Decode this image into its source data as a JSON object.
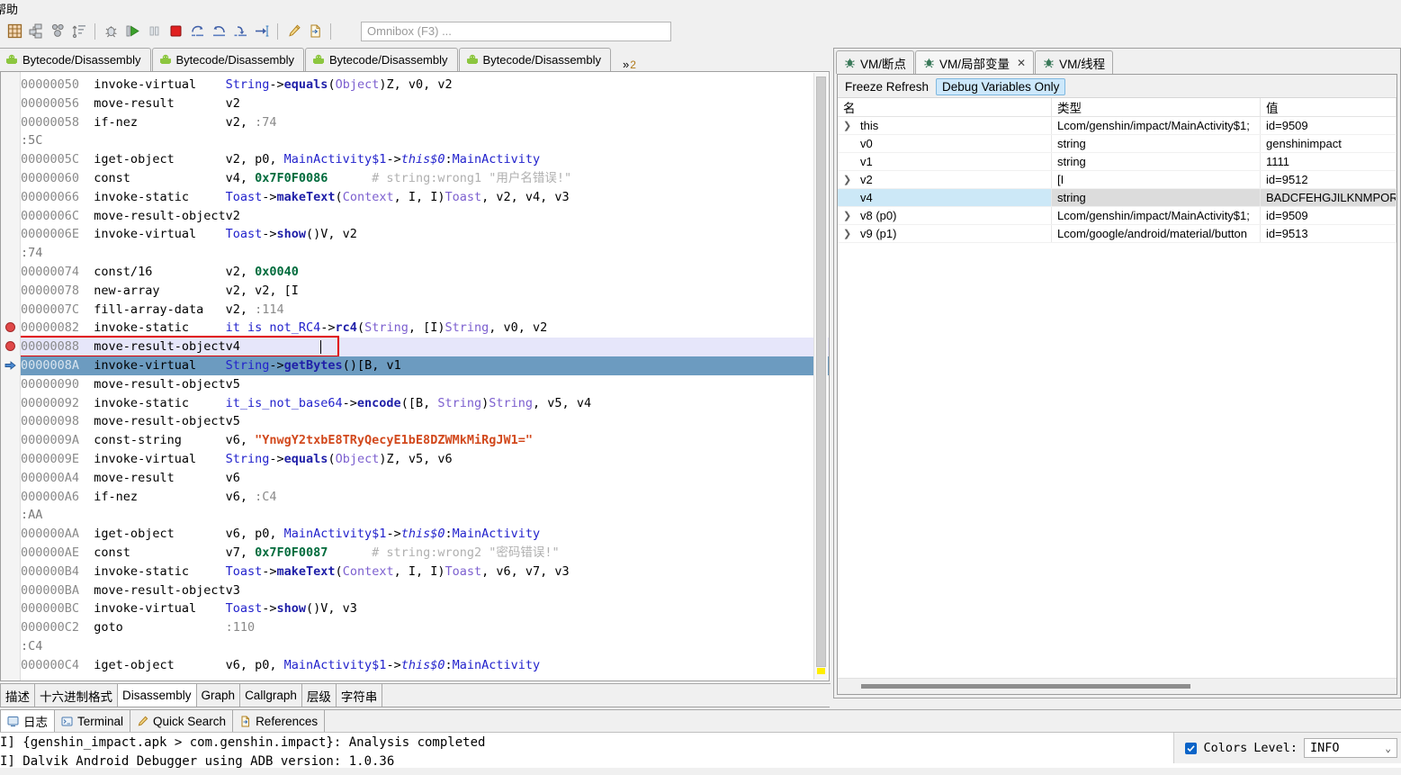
{
  "menubar": {
    "items": [
      "帮助"
    ]
  },
  "toolbar": {
    "buttons": [
      {
        "name": "grid-view-icon",
        "title": "Grid"
      },
      {
        "name": "class-hierarchy-icon",
        "title": "Hierarchy"
      },
      {
        "name": "references-icon",
        "title": "References"
      },
      {
        "name": "sort-icon",
        "title": "Sort"
      },
      {
        "name": "debug-icon",
        "title": "Debug"
      },
      {
        "name": "run-icon",
        "title": "Run"
      },
      {
        "name": "pause-icon",
        "title": "Pause"
      },
      {
        "name": "stop-icon",
        "title": "Stop"
      },
      {
        "name": "step-over-icon",
        "title": "Step Over"
      },
      {
        "name": "step-return-icon",
        "title": "Step Return"
      },
      {
        "name": "step-into-icon",
        "title": "Step Into"
      },
      {
        "name": "run-to-cursor-icon",
        "title": "Run To Cursor"
      },
      {
        "name": "highlight-icon",
        "title": "Highlight"
      },
      {
        "name": "export-icon",
        "title": "Export"
      }
    ],
    "omnibox_placeholder": "Omnibox (F3) ..."
  },
  "editor_tabs": {
    "items": [
      {
        "label": "Bytecode/Disassembly",
        "active": false
      },
      {
        "label": "Bytecode/Disassembly",
        "active": false
      },
      {
        "label": "Bytecode/Disassembly",
        "active": false
      },
      {
        "label": "Bytecode/Disassembly",
        "active": false
      }
    ],
    "overflow_symbol": "»",
    "overflow_count": "2"
  },
  "disassembly": {
    "lines": [
      {
        "addr": "00000050",
        "op": "invoke-virtual",
        "args": [
          {
            "t": "cls",
            "v": "String"
          },
          {
            "t": "op",
            "v": "->"
          },
          {
            "t": "mth",
            "v": "equals"
          },
          {
            "t": "op",
            "v": "("
          },
          {
            "t": "typ",
            "v": "Object"
          },
          {
            "t": "op",
            "v": ")Z, v0, v2"
          }
        ]
      },
      {
        "addr": "00000056",
        "op": "move-result",
        "args": [
          {
            "t": "op",
            "v": "v2"
          }
        ]
      },
      {
        "addr": "00000058",
        "op": "if-nez",
        "args": [
          {
            "t": "op",
            "v": "v2, "
          },
          {
            "t": "jmp",
            "v": ":74"
          }
        ]
      },
      {
        "label": ":5C"
      },
      {
        "addr": "0000005C",
        "op": "iget-object",
        "args": [
          {
            "t": "op",
            "v": "v2, p0, "
          },
          {
            "t": "cls",
            "v": "MainActivity$1"
          },
          {
            "t": "op",
            "v": "->"
          },
          {
            "t": "ital",
            "v": "this$0"
          },
          {
            "t": "op",
            "v": ":"
          },
          {
            "t": "cls",
            "v": "MainActivity"
          }
        ]
      },
      {
        "addr": "00000060",
        "op": "const",
        "args": [
          {
            "t": "op",
            "v": "v4, "
          },
          {
            "t": "num",
            "v": "0x7F0F0086"
          },
          {
            "t": "cmt",
            "v": "      # string:wrong1 \"用户名错误!\""
          }
        ]
      },
      {
        "addr": "00000066",
        "op": "invoke-static",
        "args": [
          {
            "t": "cls",
            "v": "Toast"
          },
          {
            "t": "op",
            "v": "->"
          },
          {
            "t": "mth",
            "v": "makeText"
          },
          {
            "t": "op",
            "v": "("
          },
          {
            "t": "typ",
            "v": "Context"
          },
          {
            "t": "op",
            "v": ", I, I)"
          },
          {
            "t": "typ",
            "v": "Toast"
          },
          {
            "t": "op",
            "v": ", v2, v4, v3"
          }
        ]
      },
      {
        "addr": "0000006C",
        "op": "move-result-object",
        "args": [
          {
            "t": "op",
            "v": "v2"
          }
        ]
      },
      {
        "addr": "0000006E",
        "op": "invoke-virtual",
        "args": [
          {
            "t": "cls",
            "v": "Toast"
          },
          {
            "t": "op",
            "v": "->"
          },
          {
            "t": "mth",
            "v": "show"
          },
          {
            "t": "op",
            "v": "()V, v2"
          }
        ]
      },
      {
        "label": ":74"
      },
      {
        "addr": "00000074",
        "op": "const/16",
        "args": [
          {
            "t": "op",
            "v": "v2, "
          },
          {
            "t": "num",
            "v": "0x0040"
          }
        ]
      },
      {
        "addr": "00000078",
        "op": "new-array",
        "args": [
          {
            "t": "op",
            "v": "v2, v2, [I"
          }
        ]
      },
      {
        "addr": "0000007C",
        "op": "fill-array-data",
        "args": [
          {
            "t": "op",
            "v": "v2, "
          },
          {
            "t": "jmp",
            "v": ":114"
          }
        ]
      },
      {
        "addr": "00000082",
        "op": "invoke-static",
        "bp": true,
        "args": [
          {
            "t": "cls",
            "v": "it is not_RC4"
          },
          {
            "t": "op",
            "v": "->"
          },
          {
            "t": "mth",
            "v": "rc4"
          },
          {
            "t": "op",
            "v": "("
          },
          {
            "t": "typ",
            "v": "String"
          },
          {
            "t": "op",
            "v": ", [I)"
          },
          {
            "t": "typ",
            "v": "String"
          },
          {
            "t": "op",
            "v": ", v0, v2"
          }
        ]
      },
      {
        "addr": "00000088",
        "op": "move-result-object",
        "bp": true,
        "hl": "lav",
        "boxed": true,
        "caret": true,
        "args": [
          {
            "t": "op",
            "v": "v4"
          }
        ]
      },
      {
        "addr": "0000008A",
        "op": "invoke-virtual",
        "ip": true,
        "hl": "sel",
        "args": [
          {
            "t": "cls",
            "v": "String"
          },
          {
            "t": "op",
            "v": "->"
          },
          {
            "t": "mth",
            "v": "getBytes"
          },
          {
            "t": "op",
            "v": "()[B, v1"
          }
        ]
      },
      {
        "addr": "00000090",
        "op": "move-result-object",
        "args": [
          {
            "t": "op",
            "v": "v5"
          }
        ]
      },
      {
        "addr": "00000092",
        "op": "invoke-static",
        "args": [
          {
            "t": "cls",
            "v": "it_is_not_base64"
          },
          {
            "t": "op",
            "v": "->"
          },
          {
            "t": "mth",
            "v": "encode"
          },
          {
            "t": "op",
            "v": "([B, "
          },
          {
            "t": "typ",
            "v": "String"
          },
          {
            "t": "op",
            "v": ")"
          },
          {
            "t": "typ",
            "v": "String"
          },
          {
            "t": "op",
            "v": ", v5, v4"
          }
        ]
      },
      {
        "addr": "00000098",
        "op": "move-result-object",
        "args": [
          {
            "t": "op",
            "v": "v5"
          }
        ]
      },
      {
        "addr": "0000009A",
        "op": "const-string",
        "args": [
          {
            "t": "op",
            "v": "v6, "
          },
          {
            "t": "str",
            "v": "\"YnwgY2txbE8TRyQecyE1bE8DZWMkMiRgJW1=\""
          }
        ]
      },
      {
        "addr": "0000009E",
        "op": "invoke-virtual",
        "args": [
          {
            "t": "cls",
            "v": "String"
          },
          {
            "t": "op",
            "v": "->"
          },
          {
            "t": "mth",
            "v": "equals"
          },
          {
            "t": "op",
            "v": "("
          },
          {
            "t": "typ",
            "v": "Object"
          },
          {
            "t": "op",
            "v": ")Z, v5, v6"
          }
        ]
      },
      {
        "addr": "000000A4",
        "op": "move-result",
        "args": [
          {
            "t": "op",
            "v": "v6"
          }
        ]
      },
      {
        "addr": "000000A6",
        "op": "if-nez",
        "args": [
          {
            "t": "op",
            "v": "v6, "
          },
          {
            "t": "jmp",
            "v": ":C4"
          }
        ]
      },
      {
        "label": ":AA"
      },
      {
        "addr": "000000AA",
        "op": "iget-object",
        "args": [
          {
            "t": "op",
            "v": "v6, p0, "
          },
          {
            "t": "cls",
            "v": "MainActivity$1"
          },
          {
            "t": "op",
            "v": "->"
          },
          {
            "t": "ital",
            "v": "this$0"
          },
          {
            "t": "op",
            "v": ":"
          },
          {
            "t": "cls",
            "v": "MainActivity"
          }
        ]
      },
      {
        "addr": "000000AE",
        "op": "const",
        "args": [
          {
            "t": "op",
            "v": "v7, "
          },
          {
            "t": "num",
            "v": "0x7F0F0087"
          },
          {
            "t": "cmt",
            "v": "      # string:wrong2 \"密码错误!\""
          }
        ]
      },
      {
        "addr": "000000B4",
        "op": "invoke-static",
        "args": [
          {
            "t": "cls",
            "v": "Toast"
          },
          {
            "t": "op",
            "v": "->"
          },
          {
            "t": "mth",
            "v": "makeText"
          },
          {
            "t": "op",
            "v": "("
          },
          {
            "t": "typ",
            "v": "Context"
          },
          {
            "t": "op",
            "v": ", I, I)"
          },
          {
            "t": "typ",
            "v": "Toast"
          },
          {
            "t": "op",
            "v": ", v6, v7, v3"
          }
        ]
      },
      {
        "addr": "000000BA",
        "op": "move-result-object",
        "args": [
          {
            "t": "op",
            "v": "v3"
          }
        ]
      },
      {
        "addr": "000000BC",
        "op": "invoke-virtual",
        "args": [
          {
            "t": "cls",
            "v": "Toast"
          },
          {
            "t": "op",
            "v": "->"
          },
          {
            "t": "mth",
            "v": "show"
          },
          {
            "t": "op",
            "v": "()V, v3"
          }
        ]
      },
      {
        "addr": "000000C2",
        "op": "goto",
        "args": [
          {
            "t": "jmp",
            "v": ":110"
          }
        ]
      },
      {
        "label": ":C4"
      },
      {
        "addr": "000000C4",
        "op": "iget-object",
        "args": [
          {
            "t": "op",
            "v": "v6, p0, "
          },
          {
            "t": "cls",
            "v": "MainActivity$1"
          },
          {
            "t": "op",
            "v": "->"
          },
          {
            "t": "ital",
            "v": "this$0"
          },
          {
            "t": "op",
            "v": ":"
          },
          {
            "t": "cls",
            "v": "MainActivity"
          }
        ]
      }
    ]
  },
  "editor_bottom_tabs": {
    "items": [
      {
        "label": "描述",
        "active": false
      },
      {
        "label": "十六进制格式",
        "active": false
      },
      {
        "label": "Disassembly",
        "active": true
      },
      {
        "label": "Graph",
        "active": false
      },
      {
        "label": "Callgraph",
        "active": false
      },
      {
        "label": "层级",
        "active": false
      },
      {
        "label": "字符串",
        "active": false
      }
    ]
  },
  "vm_panel": {
    "tabs": [
      {
        "label": "VM/断点",
        "active": false,
        "closable": false
      },
      {
        "label": "VM/局部变量",
        "active": true,
        "closable": true
      },
      {
        "label": "VM/线程",
        "active": false,
        "closable": false
      }
    ],
    "toolbar": {
      "freeze_refresh": "Freeze Refresh",
      "debug_variables_only": "Debug Variables Only"
    },
    "columns": [
      "名",
      "类型",
      "值"
    ],
    "rows": [
      {
        "expandable": true,
        "name": "this",
        "type": "Lcom/genshin/impact/MainActivity$1;",
        "value": "id=9509",
        "selected": false
      },
      {
        "expandable": false,
        "name": "v0",
        "type": "string",
        "value": "genshinimpact",
        "selected": false
      },
      {
        "expandable": false,
        "name": "v1",
        "type": "string",
        "value": "1111",
        "selected": false
      },
      {
        "expandable": true,
        "name": "v2",
        "type": "[I",
        "value": "id=9512",
        "selected": false
      },
      {
        "expandable": false,
        "name": "v4",
        "type": "string",
        "value": "BADCFEHGJILKNMPORQ",
        "selected": true,
        "value_boxed": true
      },
      {
        "expandable": true,
        "name": "v8 (p0)",
        "type": "Lcom/genshin/impact/MainActivity$1;",
        "value": "id=9509",
        "selected": false
      },
      {
        "expandable": true,
        "name": "v9 (p1)",
        "type": "Lcom/google/android/material/button",
        "value": "id=9513",
        "selected": false
      }
    ]
  },
  "bottom_panel": {
    "tabs": [
      {
        "label": "日志",
        "icon": "log-icon",
        "active": true
      },
      {
        "label": "Terminal",
        "icon": "terminal-icon",
        "active": false
      },
      {
        "label": "Quick Search",
        "icon": "search-pen-icon",
        "active": false
      },
      {
        "label": "References",
        "icon": "references-icon",
        "active": false
      }
    ],
    "console_lines": [
      "I] {genshin_impact.apk > com.genshin.impact}: Analysis completed",
      "I] Dalvik Android Debugger using ADB version: 1.0.36"
    ],
    "status": {
      "colors_label": "Colors",
      "colors_checked": true,
      "level_label": "Level:",
      "level_value": "INFO"
    }
  },
  "colors": {
    "accent": "#0a64c8",
    "selection": "#6c9bc0",
    "highlight_row": "#e6e6fa",
    "annotation_box": "#e00000",
    "breakpoint": "#e04848",
    "chip": "#cde8fb"
  }
}
